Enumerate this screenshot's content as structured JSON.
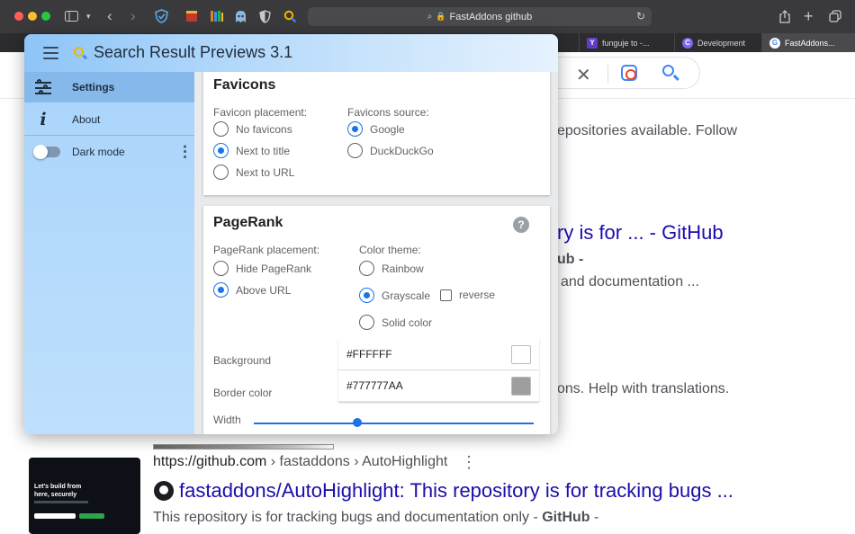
{
  "browser": {
    "address": "FastAddons github",
    "tabs": [
      {
        "label": "funguje to -...",
        "favicon": "Y"
      },
      {
        "label": "Development",
        "favicon": "C"
      },
      {
        "label": "FastAddons...",
        "favicon": "G"
      }
    ]
  },
  "google": {
    "snippet1": "epositories available. Follow",
    "result_title1": "ry is for ... - GitHub",
    "result_line1": "ub -",
    "snippet2": "and documentation ...",
    "snippet3": "ons. Help with translations.",
    "cite_domain": "https://github.com",
    "cite_path": " › fastaddons › AutoHighlight",
    "result_title2": "fastaddons/AutoHighlight: This repository is for tracking bugs ...",
    "snippet4_prefix": "This repository is for tracking bugs and documentation only - ",
    "snippet4_bold": "GitHub",
    "snippet4_suffix": " -",
    "thumb_text": "Let's build from here, securely"
  },
  "popup": {
    "title": "Search Result Previews 3.1",
    "sidebar": {
      "settings": "Settings",
      "about": "About",
      "dark_mode": "Dark mode"
    },
    "favicons": {
      "title": "Favicons",
      "placement_label": "Favicon placement:",
      "placement_options": [
        "No favicons",
        "Next to title",
        "Next to URL"
      ],
      "placement_selected": "Next to title",
      "source_label": "Favicons source:",
      "source_options": [
        "Google",
        "DuckDuckGo"
      ],
      "source_selected": "Google"
    },
    "pagerank": {
      "title": "PageRank",
      "placement_label": "PageRank placement:",
      "placement_options": [
        "Hide PageRank",
        "Above URL"
      ],
      "placement_selected": "Above URL",
      "theme_label": "Color theme:",
      "theme_options": [
        "Rainbow",
        "Grayscale",
        "Solid color"
      ],
      "theme_selected": "Grayscale",
      "reverse_label": "reverse",
      "reverse_checked": false,
      "background_label": "Background",
      "background_value": "#FFFFFF",
      "border_label": "Border color",
      "border_value": "#777777AA",
      "width_label": "Width",
      "width_fraction": 0.37
    }
  },
  "colors": {
    "accent": "#1a73e8",
    "link": "#1a0dab",
    "sidebar": "#bfe0fc",
    "swatch_background": "#FFFFFF",
    "swatch_border": "#999999"
  }
}
